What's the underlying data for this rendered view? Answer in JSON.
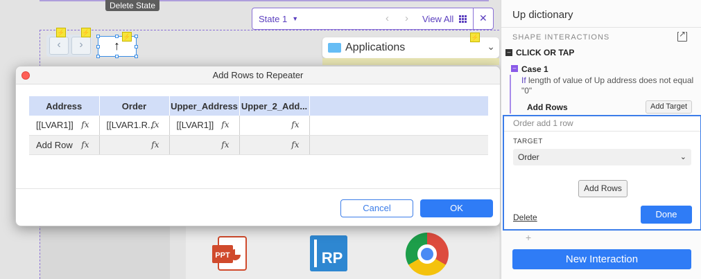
{
  "canvas": {
    "tooltip": "Delete State",
    "state_selector": {
      "label": "State 1",
      "view_all": "View All"
    },
    "apps_widget": {
      "label": "Applications"
    },
    "app_icons": {
      "ppt_label": "PPT",
      "rp_label": "RP"
    }
  },
  "dialog": {
    "title": "Add Rows to Repeater",
    "columns": [
      "Address",
      "Order",
      "Upper_Address",
      "Upper_2_Add..."
    ],
    "rows": [
      [
        "[[LVAR1]]",
        "[[LVAR1.R...",
        "[[LVAR1]]",
        ""
      ],
      [
        "Add Row",
        "",
        "",
        ""
      ]
    ],
    "cancel_label": "Cancel",
    "ok_label": "OK"
  },
  "panel": {
    "title": "Up dictionary",
    "section": "SHAPE INTERACTIONS",
    "event": "CLICK OR TAP",
    "case": {
      "name": "Case 1",
      "cond_keyword": "If",
      "cond_text": " length of value of Up address does not equal \"0\""
    },
    "action": "Add Rows",
    "add_target_label": "Add Target",
    "editor": {
      "summary": "Order add 1 row",
      "target_label": "TARGET",
      "target_value": "Order",
      "add_rows_label": "Add Rows",
      "delete_label": "Delete",
      "done_label": "Done"
    },
    "plus": "+",
    "new_interaction_label": "New Interaction"
  },
  "colors": {
    "accent": "#2f7cf6",
    "selection": "#8a70d6",
    "header_fill": "#d2def8"
  }
}
